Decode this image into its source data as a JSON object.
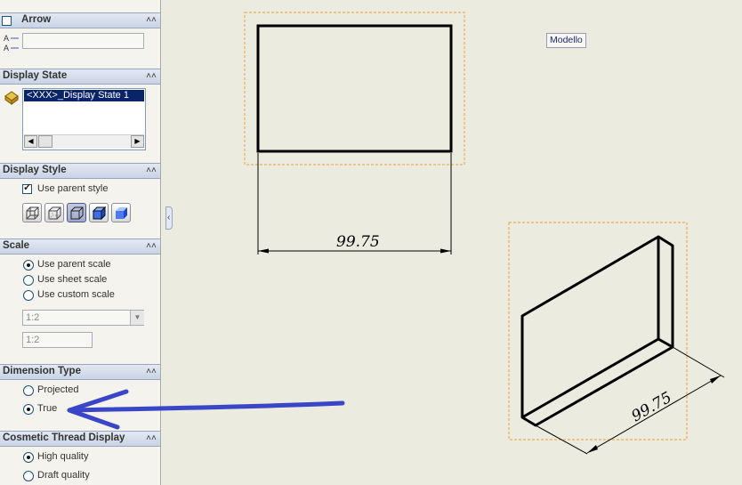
{
  "sections": {
    "arrow": {
      "title": "Arrow",
      "checked": false,
      "text_value": ""
    },
    "display_state": {
      "title": "Display State",
      "list_items": [
        "<XXX>_Display State 1"
      ]
    },
    "display_style": {
      "title": "Display Style",
      "use_parent_label": "Use parent style",
      "use_parent_checked": true,
      "buttons": [
        "wireframe-icon",
        "hidden-lines-visible-icon",
        "hidden-lines-removed-icon",
        "shaded-with-edges-icon",
        "shaded-icon"
      ],
      "active_button": "hidden-lines-removed-icon"
    },
    "scale": {
      "title": "Scale",
      "options": [
        "Use parent scale",
        "Use sheet scale",
        "Use custom scale"
      ],
      "selected": "Use parent scale",
      "dropdown_value": "1:2",
      "custom_value": "1:2"
    },
    "dimension_type": {
      "title": "Dimension Type",
      "options": [
        "Projected",
        "True"
      ],
      "selected": "True"
    },
    "cosmetic_thread": {
      "title": "Cosmetic Thread Display",
      "options": [
        "High quality",
        "Draft quality"
      ],
      "selected": "High quality"
    }
  },
  "drawing": {
    "tag_label": "Modello",
    "front_view_dimension": "99.75",
    "iso_view_dimension": "99.75"
  },
  "colors": {
    "panel_bg": "#f4f3ee",
    "section_header": "#c9d3e4",
    "canvas_bg": "#ecebe0",
    "view_border": "#f59b34",
    "annotation_arrow": "#3a46c8"
  }
}
